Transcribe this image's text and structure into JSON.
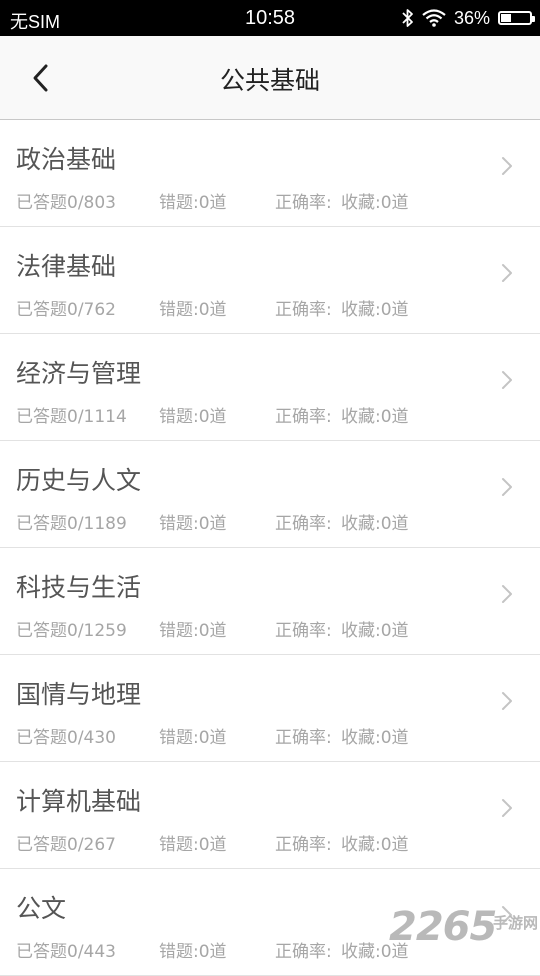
{
  "status_bar": {
    "carrier": "无SIM",
    "time": "10:58",
    "battery_percent": "36%",
    "battery_level": 0.36,
    "icons": [
      "bluetooth-icon",
      "wifi-icon",
      "battery-icon"
    ]
  },
  "nav": {
    "title": "公共基础",
    "back_icon": "chevron-left-icon"
  },
  "categories": [
    {
      "name": "政治基础",
      "answered": "已答题0/803",
      "wrong": "错题:0道",
      "accuracy": "正确率:",
      "favorites": "收藏:0道"
    },
    {
      "name": "法律基础",
      "answered": "已答题0/762",
      "wrong": "错题:0道",
      "accuracy": "正确率:",
      "favorites": "收藏:0道"
    },
    {
      "name": "经济与管理",
      "answered": "已答题0/1114",
      "wrong": "错题:0道",
      "accuracy": "正确率:",
      "favorites": "收藏:0道"
    },
    {
      "name": "历史与人文",
      "answered": "已答题0/1189",
      "wrong": "错题:0道",
      "accuracy": "正确率:",
      "favorites": "收藏:0道"
    },
    {
      "name": "科技与生活",
      "answered": "已答题0/1259",
      "wrong": "错题:0道",
      "accuracy": "正确率:",
      "favorites": "收藏:0道"
    },
    {
      "name": "国情与地理",
      "answered": "已答题0/430",
      "wrong": "错题:0道",
      "accuracy": "正确率:",
      "favorites": "收藏:0道"
    },
    {
      "name": "计算机基础",
      "answered": "已答题0/267",
      "wrong": "错题:0道",
      "accuracy": "正确率:",
      "favorites": "收藏:0道"
    },
    {
      "name": "公文",
      "answered": "已答题0/443",
      "wrong": "错题:0道",
      "accuracy": "正确率:",
      "favorites": "收藏:0道"
    }
  ],
  "watermark": {
    "number": "2265",
    "suffix": "手游网"
  },
  "colors": {
    "status_bar_bg": "#000000",
    "nav_bg": "#f9f9f9",
    "title_text": "#555555",
    "meta_text": "#a6a6a6",
    "divider": "#e2e2e2"
  }
}
